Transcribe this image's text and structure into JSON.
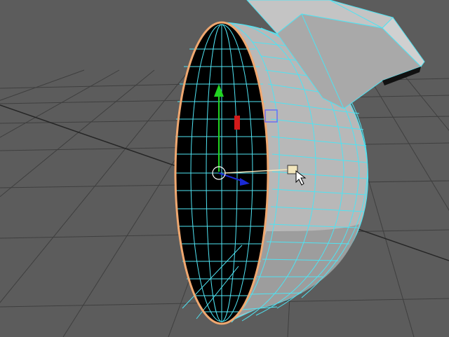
{
  "app": {
    "panel": "perspective-viewport",
    "mode": "component-edit"
  },
  "viewport": {
    "background_color": "#5c5c5c",
    "grid_color": "#3f3f3f",
    "grid_axis_color": "#262626",
    "wireframe_color": "#4fe3f2",
    "selection_color": "#f0a870",
    "surface_color": "#b8b8b8",
    "surface_shadow_color": "#8e8e8e",
    "interior_color": "#000000"
  },
  "manipulator": {
    "type": "move-tool",
    "y_axis_color": "#22d422",
    "x_axis_color": "#d41a1a",
    "z_axis_color": "#1a2ad4",
    "center_color": "#ffffff",
    "plane_handle_color": "#6d6df0",
    "slide_handle_color": "#f2e6bc"
  },
  "icons": {
    "cursor": "arrow-cursor-icon",
    "tool_indicator": "move-tool-icon"
  }
}
